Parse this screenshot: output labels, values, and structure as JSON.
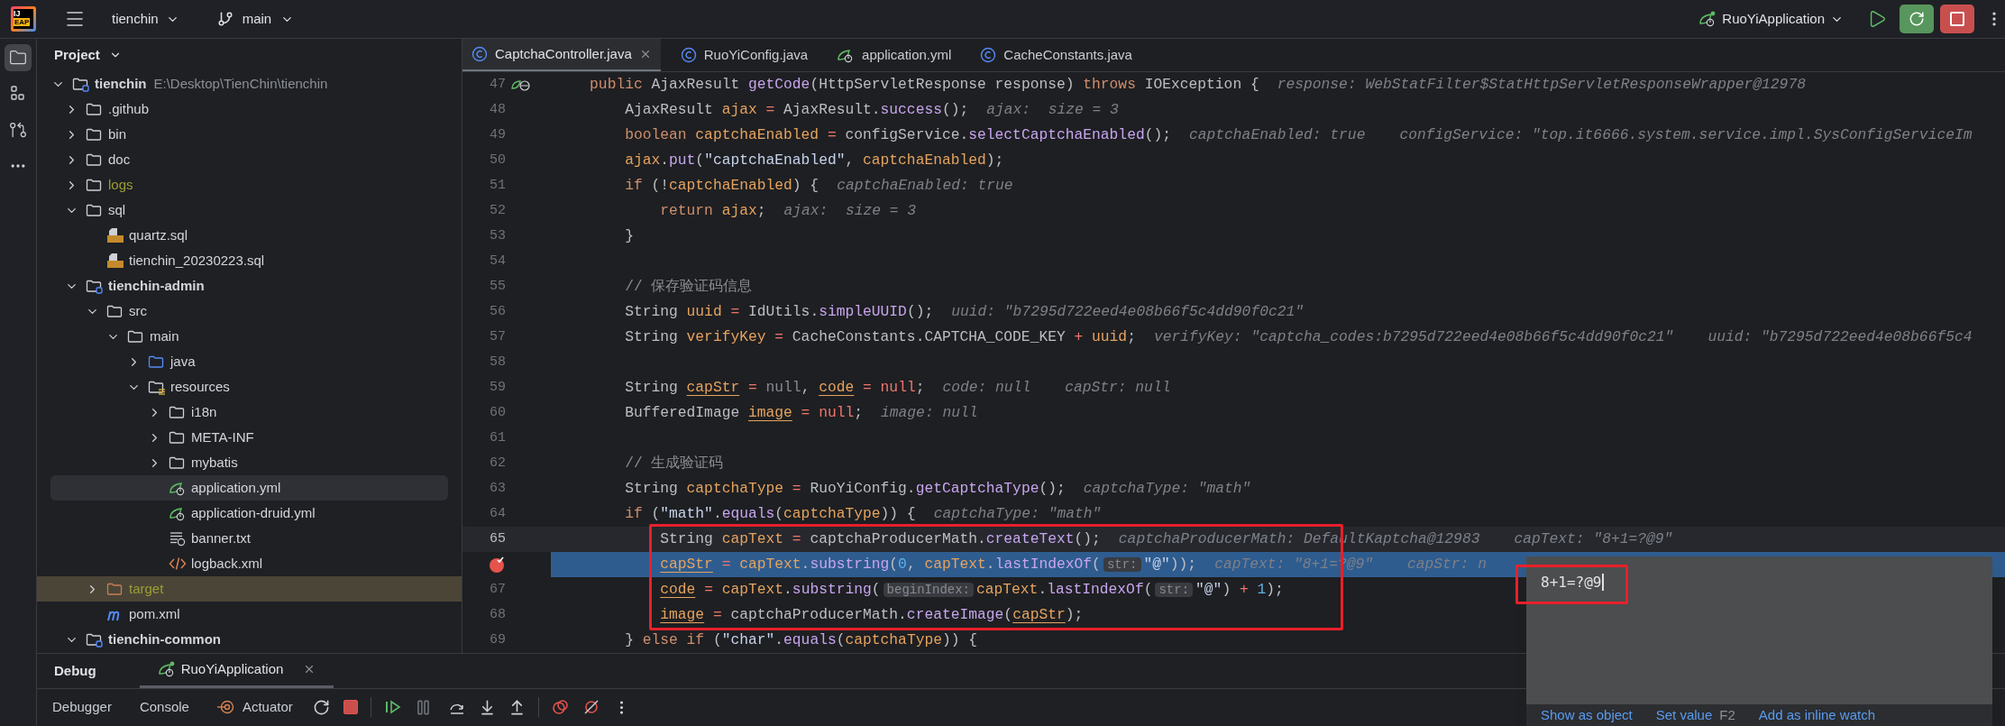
{
  "toolbar": {
    "logo_text": "IJ",
    "logo_badge": "EAP",
    "project": "tienchin",
    "branch": "main",
    "run_config": "RuoYiApplication"
  },
  "tool_stripe": [
    {
      "kind": "project",
      "selected": true
    },
    {
      "kind": "structure",
      "selected": false
    },
    {
      "kind": "commits",
      "selected": false
    },
    {
      "kind": "more",
      "selected": false
    }
  ],
  "project_panel": {
    "title": "Project",
    "tree": [
      {
        "name": "tienchin",
        "path": "E:\\Desktop\\TienChin\\tienchin",
        "kind": "module",
        "expanded": true,
        "selected": false,
        "ignored": false,
        "children": [
          {
            "name": ".github",
            "kind": "folder",
            "expanded": false,
            "selected": false,
            "ignored": false
          },
          {
            "name": "bin",
            "kind": "folder",
            "expanded": false,
            "selected": false,
            "ignored": false
          },
          {
            "name": "doc",
            "kind": "folder",
            "expanded": false,
            "selected": false,
            "ignored": false
          },
          {
            "name": "logs",
            "kind": "folder",
            "expanded": false,
            "selected": false,
            "ignored": true
          },
          {
            "name": "sql",
            "kind": "folder",
            "expanded": true,
            "selected": false,
            "ignored": false,
            "children": [
              {
                "name": "quartz.sql",
                "kind": "sql",
                "selected": false,
                "ignored": false
              },
              {
                "name": "tienchin_20230223.sql",
                "kind": "sql",
                "selected": false,
                "ignored": false
              }
            ]
          },
          {
            "name": "tienchin-admin",
            "kind": "module",
            "expanded": true,
            "selected": false,
            "ignored": false,
            "children": [
              {
                "name": "src",
                "kind": "folder",
                "expanded": true,
                "selected": false,
                "ignored": false,
                "children": [
                  {
                    "name": "main",
                    "kind": "folder",
                    "expanded": true,
                    "selected": false,
                    "ignored": false,
                    "children": [
                      {
                        "name": "java",
                        "kind": "source",
                        "expanded": false,
                        "selected": false,
                        "ignored": false
                      },
                      {
                        "name": "resources",
                        "kind": "resources",
                        "expanded": true,
                        "selected": false,
                        "ignored": false,
                        "children": [
                          {
                            "name": "i18n",
                            "kind": "folder",
                            "expanded": false,
                            "selected": false,
                            "ignored": false
                          },
                          {
                            "name": "META-INF",
                            "kind": "folder",
                            "expanded": false,
                            "selected": false,
                            "ignored": false
                          },
                          {
                            "name": "mybatis",
                            "kind": "folder",
                            "expanded": false,
                            "selected": false,
                            "ignored": false
                          },
                          {
                            "name": "application.yml",
                            "kind": "yml",
                            "selected": true,
                            "ignored": false
                          },
                          {
                            "name": "application-druid.yml",
                            "kind": "yml",
                            "selected": false,
                            "ignored": false
                          },
                          {
                            "name": "banner.txt",
                            "kind": "txt",
                            "selected": false,
                            "ignored": false
                          },
                          {
                            "name": "logback.xml",
                            "kind": "xml",
                            "selected": false,
                            "ignored": false
                          }
                        ]
                      }
                    ]
                  }
                ]
              },
              {
                "name": "target",
                "kind": "excluded",
                "expanded": false,
                "selected": false,
                "ignored": true
              },
              {
                "name": "pom.xml",
                "kind": "maven",
                "selected": false,
                "ignored": false
              }
            ]
          },
          {
            "name": "tienchin-common",
            "kind": "module",
            "expanded": true,
            "selected": false,
            "ignored": false
          }
        ]
      }
    ]
  },
  "editor": {
    "tabs": [
      {
        "label": "CaptchaController.java",
        "kind": "class",
        "selected": true,
        "closable": true
      },
      {
        "label": "RuoYiConfig.java",
        "kind": "class",
        "selected": false,
        "closable": false
      },
      {
        "label": "application.yml",
        "kind": "yml",
        "selected": false,
        "closable": false
      },
      {
        "label": "CacheConstants.java",
        "kind": "class",
        "selected": false,
        "closable": false
      }
    ],
    "lines": [
      {
        "number": "47",
        "kind": "endpoint",
        "code": [
          {
            "kind": "kw",
            "text": "    public "
          },
          {
            "kind": "plain",
            "text": "AjaxResult "
          },
          {
            "kind": "method",
            "text": "getCode"
          },
          {
            "kind": "plain",
            "text": "(HttpServletResponse response) "
          },
          {
            "kind": "kw",
            "text": "throws "
          },
          {
            "kind": "plain",
            "text": "IOException {"
          }
        ],
        "hints": [
          "response: WebStatFilter$StatHttpServletResponseWrapper@12978"
        ],
        "current": false,
        "caret": false,
        "breakpoint": false,
        "framed": false
      },
      {
        "number": "48",
        "kind": "plain",
        "code": [
          {
            "kind": "plain",
            "text": "        AjaxResult "
          },
          {
            "kind": "var",
            "text": "ajax"
          },
          {
            "kind": "op",
            "text": " = "
          },
          {
            "kind": "plain",
            "text": "AjaxResult."
          },
          {
            "kind": "method",
            "text": "success"
          },
          {
            "kind": "plain",
            "text": "();"
          }
        ],
        "hints": [
          "ajax:  size = 3"
        ],
        "current": false,
        "caret": false,
        "breakpoint": false,
        "framed": false
      },
      {
        "number": "49",
        "kind": "plain",
        "code": [
          {
            "kind": "kw",
            "text": "        boolean "
          },
          {
            "kind": "var",
            "text": "captchaEnabled"
          },
          {
            "kind": "op",
            "text": " = "
          },
          {
            "kind": "plain",
            "text": "configService."
          },
          {
            "kind": "method",
            "text": "selectCaptchaEnabled"
          },
          {
            "kind": "plain",
            "text": "();"
          }
        ],
        "hints": [
          "captchaEnabled: true",
          "configService: \"top.it6666.system.service.impl.SysConfigServiceIm"
        ],
        "current": false,
        "caret": false,
        "breakpoint": false,
        "framed": false
      },
      {
        "number": "50",
        "kind": "plain",
        "code": [
          {
            "kind": "var",
            "text": "        ajax"
          },
          {
            "kind": "plain",
            "text": "."
          },
          {
            "kind": "method",
            "text": "put"
          },
          {
            "kind": "plain",
            "text": "("
          },
          {
            "kind": "str",
            "text": "\"captchaEnabled\""
          },
          {
            "kind": "plain",
            "text": ", "
          },
          {
            "kind": "var",
            "text": "captchaEnabled"
          },
          {
            "kind": "plain",
            "text": ");"
          }
        ],
        "current": false,
        "caret": false,
        "breakpoint": false,
        "framed": false
      },
      {
        "number": "51",
        "kind": "plain",
        "code": [
          {
            "kind": "kw",
            "text": "        if "
          },
          {
            "kind": "plain",
            "text": "(!"
          },
          {
            "kind": "var",
            "text": "captchaEnabled"
          },
          {
            "kind": "plain",
            "text": ") {"
          }
        ],
        "hints": [
          "captchaEnabled: true"
        ],
        "current": false,
        "caret": false,
        "breakpoint": false,
        "framed": false
      },
      {
        "number": "52",
        "kind": "plain",
        "code": [
          {
            "kind": "kw",
            "text": "            return "
          },
          {
            "kind": "var",
            "text": "ajax"
          },
          {
            "kind": "plain",
            "text": ";"
          }
        ],
        "hints": [
          "ajax:  size = 3"
        ],
        "current": false,
        "caret": false,
        "breakpoint": false,
        "framed": false
      },
      {
        "number": "53",
        "kind": "plain",
        "code": [
          {
            "kind": "plain",
            "text": "        }"
          }
        ],
        "current": false,
        "caret": false,
        "breakpoint": false,
        "framed": false
      },
      {
        "number": "54",
        "kind": "plain",
        "current": false,
        "caret": false,
        "breakpoint": false,
        "framed": false
      },
      {
        "number": "55",
        "kind": "plain",
        "code": [
          {
            "kind": "comment",
            "text": "        // 保存验证码信息"
          }
        ],
        "current": false,
        "caret": false,
        "breakpoint": false,
        "framed": false
      },
      {
        "number": "56",
        "kind": "plain",
        "code": [
          {
            "kind": "plain",
            "text": "        String "
          },
          {
            "kind": "var",
            "text": "uuid"
          },
          {
            "kind": "op",
            "text": " = "
          },
          {
            "kind": "plain",
            "text": "IdUtils."
          },
          {
            "kind": "method",
            "text": "simpleUUID"
          },
          {
            "kind": "plain",
            "text": "();"
          }
        ],
        "hints": [
          "uuid: \"b7295d722eed4e08b66f5c4dd90f0c21\""
        ],
        "current": false,
        "caret": false,
        "breakpoint": false,
        "framed": false
      },
      {
        "number": "57",
        "kind": "plain",
        "code": [
          {
            "kind": "plain",
            "text": "        String "
          },
          {
            "kind": "var",
            "text": "verifyKey"
          },
          {
            "kind": "op",
            "text": " = "
          },
          {
            "kind": "plain",
            "text": "CacheConstants.CAPTCHA_CODE_KEY "
          },
          {
            "kind": "op",
            "text": "+ "
          },
          {
            "kind": "var",
            "text": "uuid"
          },
          {
            "kind": "plain",
            "text": ";"
          }
        ],
        "hints": [
          "verifyKey: \"captcha_codes:b7295d722eed4e08b66f5c4dd90f0c21\"",
          "uuid: \"b7295d722eed4e08b66f5c4"
        ],
        "current": false,
        "caret": false,
        "breakpoint": false,
        "framed": false
      },
      {
        "number": "58",
        "kind": "plain",
        "current": false,
        "caret": false,
        "breakpoint": false,
        "framed": false
      },
      {
        "number": "59",
        "kind": "plain",
        "code": [
          {
            "kind": "plain",
            "text": "        String "
          },
          {
            "kind": "uvar",
            "text": "capStr"
          },
          {
            "kind": "op",
            "text": " = "
          },
          {
            "kind": "dim",
            "text": "null"
          },
          {
            "kind": "plain",
            "text": ", "
          },
          {
            "kind": "uvar",
            "text": "code"
          },
          {
            "kind": "op",
            "text": " = "
          },
          {
            "kind": "op",
            "text": "null"
          },
          {
            "kind": "plain",
            "text": ";"
          }
        ],
        "hints": [
          "code: null",
          "capStr: null"
        ],
        "current": false,
        "caret": false,
        "breakpoint": false,
        "framed": false
      },
      {
        "number": "60",
        "kind": "plain",
        "code": [
          {
            "kind": "plain",
            "text": "        BufferedImage "
          },
          {
            "kind": "uvar",
            "text": "image"
          },
          {
            "kind": "op",
            "text": " = "
          },
          {
            "kind": "op",
            "text": "null"
          },
          {
            "kind": "plain",
            "text": ";"
          }
        ],
        "hints": [
          "image: null"
        ],
        "current": false,
        "caret": false,
        "breakpoint": false,
        "framed": false
      },
      {
        "number": "61",
        "kind": "plain",
        "current": false,
        "caret": false,
        "breakpoint": false,
        "framed": false
      },
      {
        "number": "62",
        "kind": "plain",
        "code": [
          {
            "kind": "comment",
            "text": "        // 生成验证码"
          }
        ],
        "current": false,
        "caret": false,
        "breakpoint": false,
        "framed": false
      },
      {
        "number": "63",
        "kind": "plain",
        "code": [
          {
            "kind": "plain",
            "text": "        String "
          },
          {
            "kind": "var",
            "text": "captchaType"
          },
          {
            "kind": "op",
            "text": " = "
          },
          {
            "kind": "plain",
            "text": "RuoYiConfig."
          },
          {
            "kind": "method",
            "text": "getCaptchaType"
          },
          {
            "kind": "plain",
            "text": "();"
          }
        ],
        "hints": [
          "captchaType: \"math\""
        ],
        "current": false,
        "caret": false,
        "breakpoint": false,
        "framed": false
      },
      {
        "number": "64",
        "kind": "plain",
        "code": [
          {
            "kind": "kw",
            "text": "        if "
          },
          {
            "kind": "plain",
            "text": "("
          },
          {
            "kind": "str",
            "text": "\"math\""
          },
          {
            "kind": "plain",
            "text": "."
          },
          {
            "kind": "method",
            "text": "equals"
          },
          {
            "kind": "plain",
            "text": "("
          },
          {
            "kind": "var",
            "text": "captchaType"
          },
          {
            "kind": "plain",
            "text": ")) {"
          }
        ],
        "hints": [
          "captchaType: \"math\""
        ],
        "current": false,
        "caret": false,
        "breakpoint": false,
        "framed": false
      },
      {
        "number": "65",
        "kind": "plain",
        "code": [
          {
            "kind": "plain",
            "text": "            String "
          },
          {
            "kind": "var",
            "text": "capText"
          },
          {
            "kind": "op",
            "text": " = "
          },
          {
            "kind": "plain",
            "text": "captchaProducerMath."
          },
          {
            "kind": "method",
            "text": "createText"
          },
          {
            "kind": "plain",
            "text": "();"
          }
        ],
        "hints": [
          "captchaProducerMath: DefaultKaptcha@12983",
          "capText: \"8+1=?@9\""
        ],
        "current": false,
        "caret": true,
        "breakpoint": false,
        "framed": true
      },
      {
        "kind": "plain",
        "code": [
          {
            "kind": "uvar",
            "text": "            capStr"
          },
          {
            "kind": "op",
            "text": " = "
          },
          {
            "kind": "var",
            "text": "capText"
          },
          {
            "kind": "plain",
            "text": "."
          },
          {
            "kind": "method",
            "text": "substring"
          },
          {
            "kind": "plain",
            "text": "("
          },
          {
            "kind": "num",
            "text": "0"
          },
          {
            "kind": "plain",
            "text": ", "
          },
          {
            "kind": "var",
            "text": "capText"
          },
          {
            "kind": "plain",
            "text": "."
          },
          {
            "kind": "method",
            "text": "lastIndexOf"
          },
          {
            "kind": "plain",
            "text": "("
          },
          {
            "kind": "param",
            "text": "str:"
          },
          {
            "kind": "str",
            "text": "\"@\""
          },
          {
            "kind": "plain",
            "text": "));"
          }
        ],
        "hints": [
          "capText: \"8+1=?@9\"",
          "capStr: n"
        ],
        "current": true,
        "caret": false,
        "breakpoint": true,
        "framed": true
      },
      {
        "number": "67",
        "kind": "plain",
        "code": [
          {
            "kind": "uvar",
            "text": "            code"
          },
          {
            "kind": "op",
            "text": " = "
          },
          {
            "kind": "var",
            "text": "capText"
          },
          {
            "kind": "plain",
            "text": "."
          },
          {
            "kind": "method",
            "text": "substring"
          },
          {
            "kind": "plain",
            "text": "("
          },
          {
            "kind": "param",
            "text": "beginIndex:"
          },
          {
            "kind": "var",
            "text": "capText"
          },
          {
            "kind": "plain",
            "text": "."
          },
          {
            "kind": "method",
            "text": "lastIndexOf"
          },
          {
            "kind": "plain",
            "text": "("
          },
          {
            "kind": "param",
            "text": "str:"
          },
          {
            "kind": "str",
            "text": "\"@\""
          },
          {
            "kind": "plain",
            "text": ") "
          },
          {
            "kind": "op",
            "text": "+ "
          },
          {
            "kind": "num",
            "text": "1"
          },
          {
            "kind": "plain",
            "text": ");"
          }
        ],
        "current": false,
        "caret": false,
        "breakpoint": false,
        "framed": true
      },
      {
        "number": "68",
        "kind": "plain",
        "code": [
          {
            "kind": "uvar",
            "text": "            image"
          },
          {
            "kind": "op",
            "text": " = "
          },
          {
            "kind": "plain",
            "text": "captchaProducerMath."
          },
          {
            "kind": "method",
            "text": "createImage"
          },
          {
            "kind": "plain",
            "text": "("
          },
          {
            "kind": "uvar",
            "text": "capStr"
          },
          {
            "kind": "plain",
            "text": ");"
          }
        ],
        "current": false,
        "caret": false,
        "breakpoint": false,
        "framed": true
      },
      {
        "number": "69",
        "kind": "plain",
        "code": [
          {
            "kind": "plain",
            "text": "        } "
          },
          {
            "kind": "kw",
            "text": "else if "
          },
          {
            "kind": "plain",
            "text": "("
          },
          {
            "kind": "str",
            "text": "\"char\""
          },
          {
            "kind": "plain",
            "text": "."
          },
          {
            "kind": "method",
            "text": "equals"
          },
          {
            "kind": "plain",
            "text": "("
          },
          {
            "kind": "var",
            "text": "captchaType"
          },
          {
            "kind": "plain",
            "text": ")) {"
          }
        ],
        "current": false,
        "caret": false,
        "breakpoint": false,
        "framed": false
      }
    ]
  },
  "debug_panel": {
    "title": "Debug",
    "session": {
      "label": "RuoYiApplication",
      "selected": true
    },
    "views": [
      {
        "label": "Debugger",
        "kind": "plain"
      },
      {
        "label": "Console",
        "kind": "plain"
      },
      {
        "label": "Actuator",
        "kind": "actuator"
      }
    ]
  },
  "value_popup": {
    "value": "8+1=?@9",
    "framed": true,
    "actions": [
      {
        "label": "Show as object",
        "kind": "link"
      },
      {
        "label": "Set value",
        "kind": "link"
      },
      {
        "label": "F2",
        "kind": "shortcut"
      },
      {
        "label": "Add as inline watch",
        "kind": "link"
      }
    ]
  }
}
